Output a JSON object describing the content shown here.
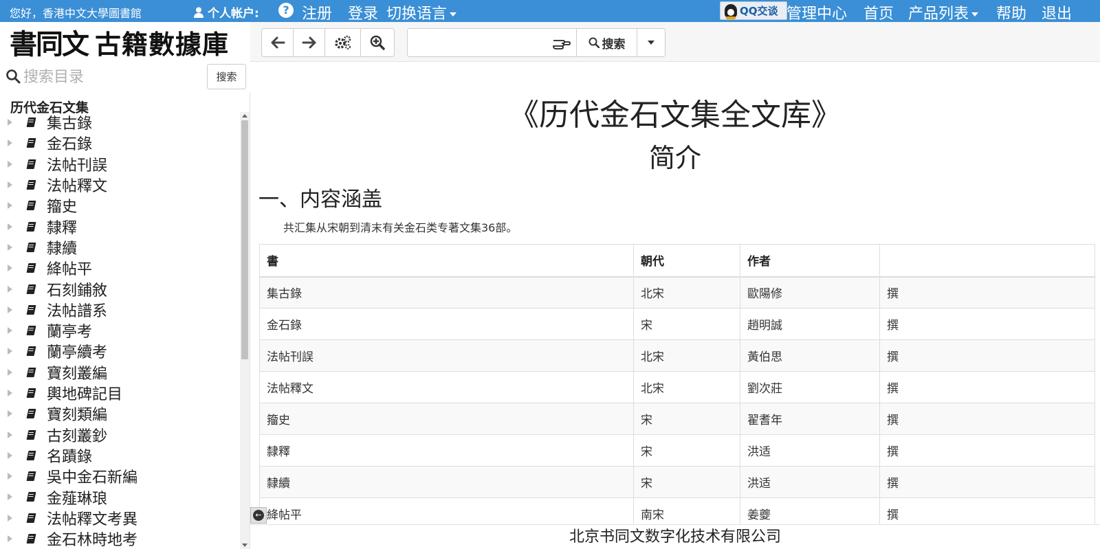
{
  "topbar": {
    "greeting": "您好，香港中文大學圖書館",
    "account_label": "个人帐户:",
    "register": "注册",
    "login": "登录",
    "language": "切换语言",
    "qq_label": "QQ交谈",
    "admin": "管理中心",
    "home": "首页",
    "products": "产品列表",
    "help": "帮助",
    "logout": "退出"
  },
  "logo": {
    "calligraphy": "書同文",
    "name": "古籍數據庫"
  },
  "toolbar": {
    "search_value": "",
    "search_label": "搜索"
  },
  "sidebar": {
    "search_placeholder": "搜索目录",
    "search_button": "搜索",
    "tree_title": "历代金石文集",
    "items": [
      "集古錄",
      "金石錄",
      "法帖刊誤",
      "法帖釋文",
      "籀史",
      "隸釋",
      "隸續",
      "絳帖平",
      "石刻鋪敘",
      "法帖譜系",
      "蘭亭考",
      "蘭亭續考",
      "寶刻叢編",
      "輿地碑記目",
      "寶刻類編",
      "古刻叢鈔",
      "名蹟錄",
      "吳中金石新編",
      "金薤琳琅",
      "法帖釋文考異",
      "金石林時地考"
    ]
  },
  "main": {
    "title": "《历代金石文集全文库》",
    "subtitle": "简介",
    "section_heading": "一、内容涵盖",
    "paragraph": "共汇集从宋朝到清末有关金石类专著文集36部。",
    "table": {
      "headers": [
        "書",
        "朝代",
        "作者",
        ""
      ],
      "rows": [
        [
          "集古錄",
          "北宋",
          "歐陽修",
          "撰"
        ],
        [
          "金石錄",
          "宋",
          "趙明誠",
          "撰"
        ],
        [
          "法帖刊誤",
          "北宋",
          "黃伯思",
          "撰"
        ],
        [
          "法帖釋文",
          "北宋",
          "劉次莊",
          "撰"
        ],
        [
          "籀史",
          "宋",
          "翟耆年",
          "撰"
        ],
        [
          "隸釋",
          "宋",
          "洪适",
          "撰"
        ],
        [
          "隸續",
          "宋",
          "洪适",
          "撰"
        ],
        [
          "絳帖平",
          "南宋",
          "姜夔",
          "撰"
        ]
      ]
    }
  },
  "footer": {
    "company": "北京书同文数字化技术有限公司"
  },
  "colors": {
    "topbar": "#3a8fd6",
    "text": "#333333"
  }
}
